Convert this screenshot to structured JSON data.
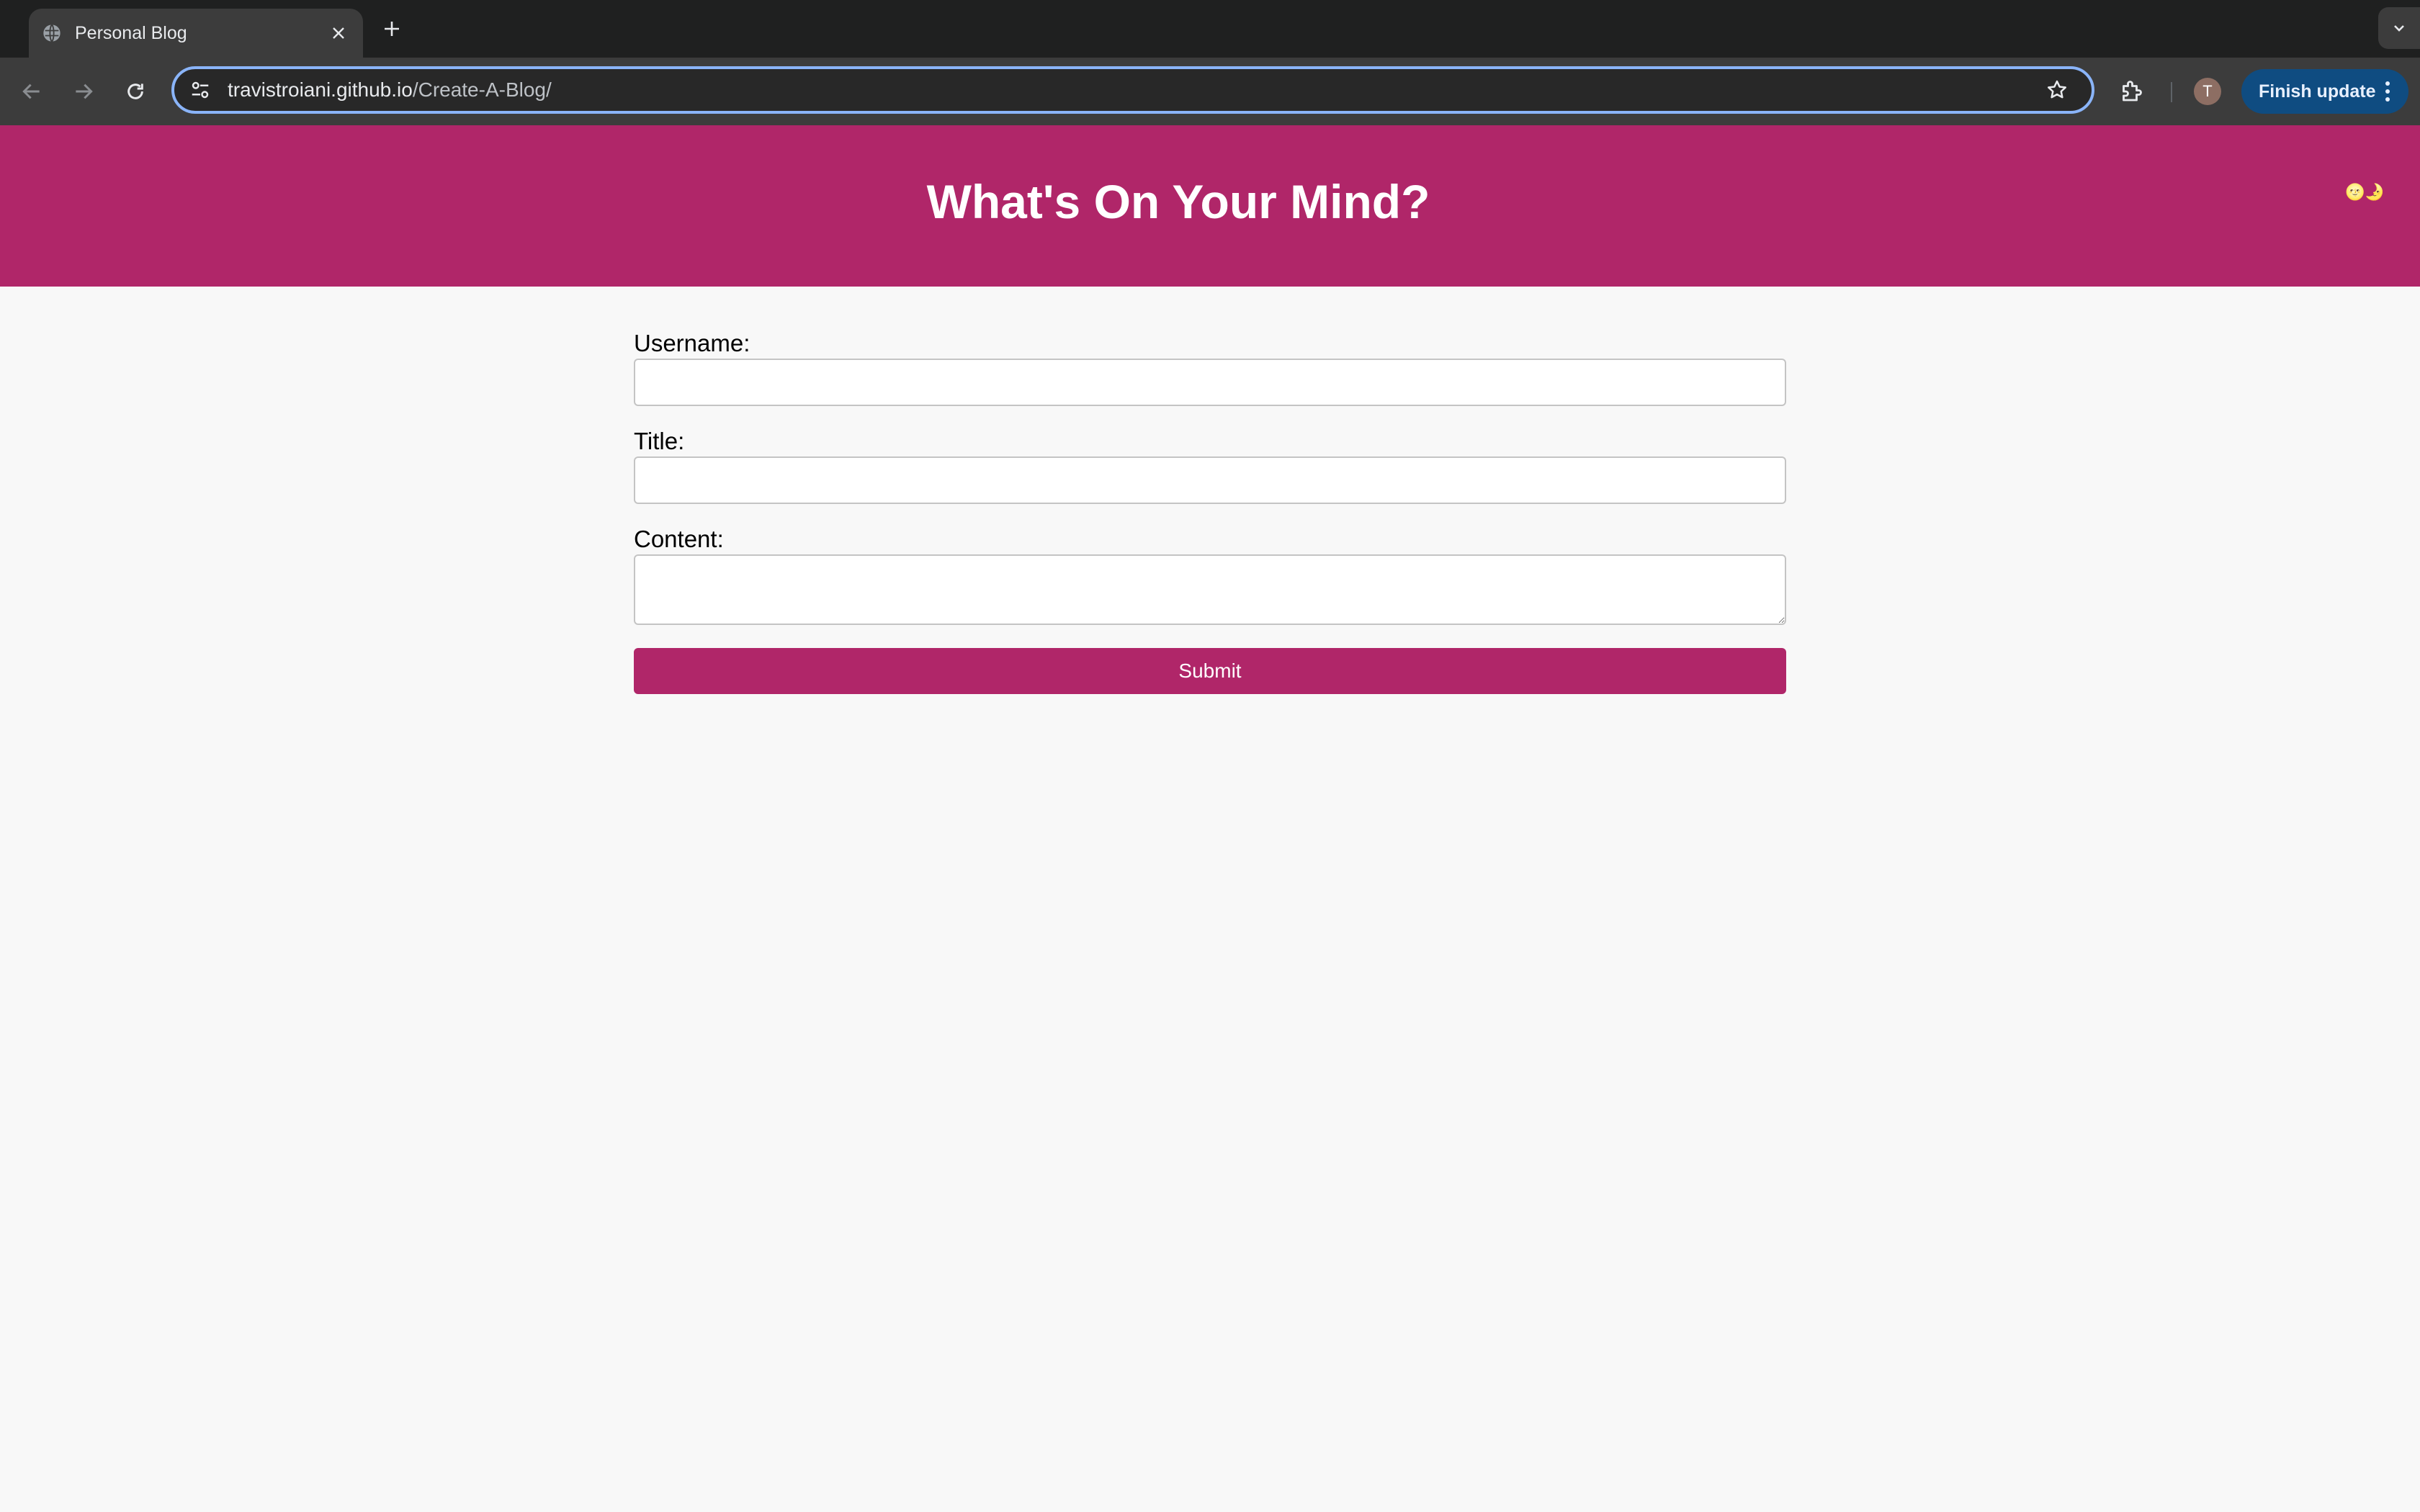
{
  "browser": {
    "tab_title": "Personal Blog",
    "url_host": "travistroiani.github.io",
    "url_path": "/Create-A-Blog/",
    "avatar_initial": "T",
    "finish_update_label": "Finish update"
  },
  "page": {
    "heading": "What's On Your Mind?",
    "mode_toggle": "🌝🌛"
  },
  "form": {
    "username_label": "Username:",
    "username_value": "",
    "title_label": "Title:",
    "title_value": "",
    "content_label": "Content:",
    "content_value": "",
    "submit_label": "Submit"
  },
  "colors": {
    "brand": "#b02669",
    "page_background": "#f8f8f8",
    "omnibox_focus": "#8ab4f8"
  }
}
